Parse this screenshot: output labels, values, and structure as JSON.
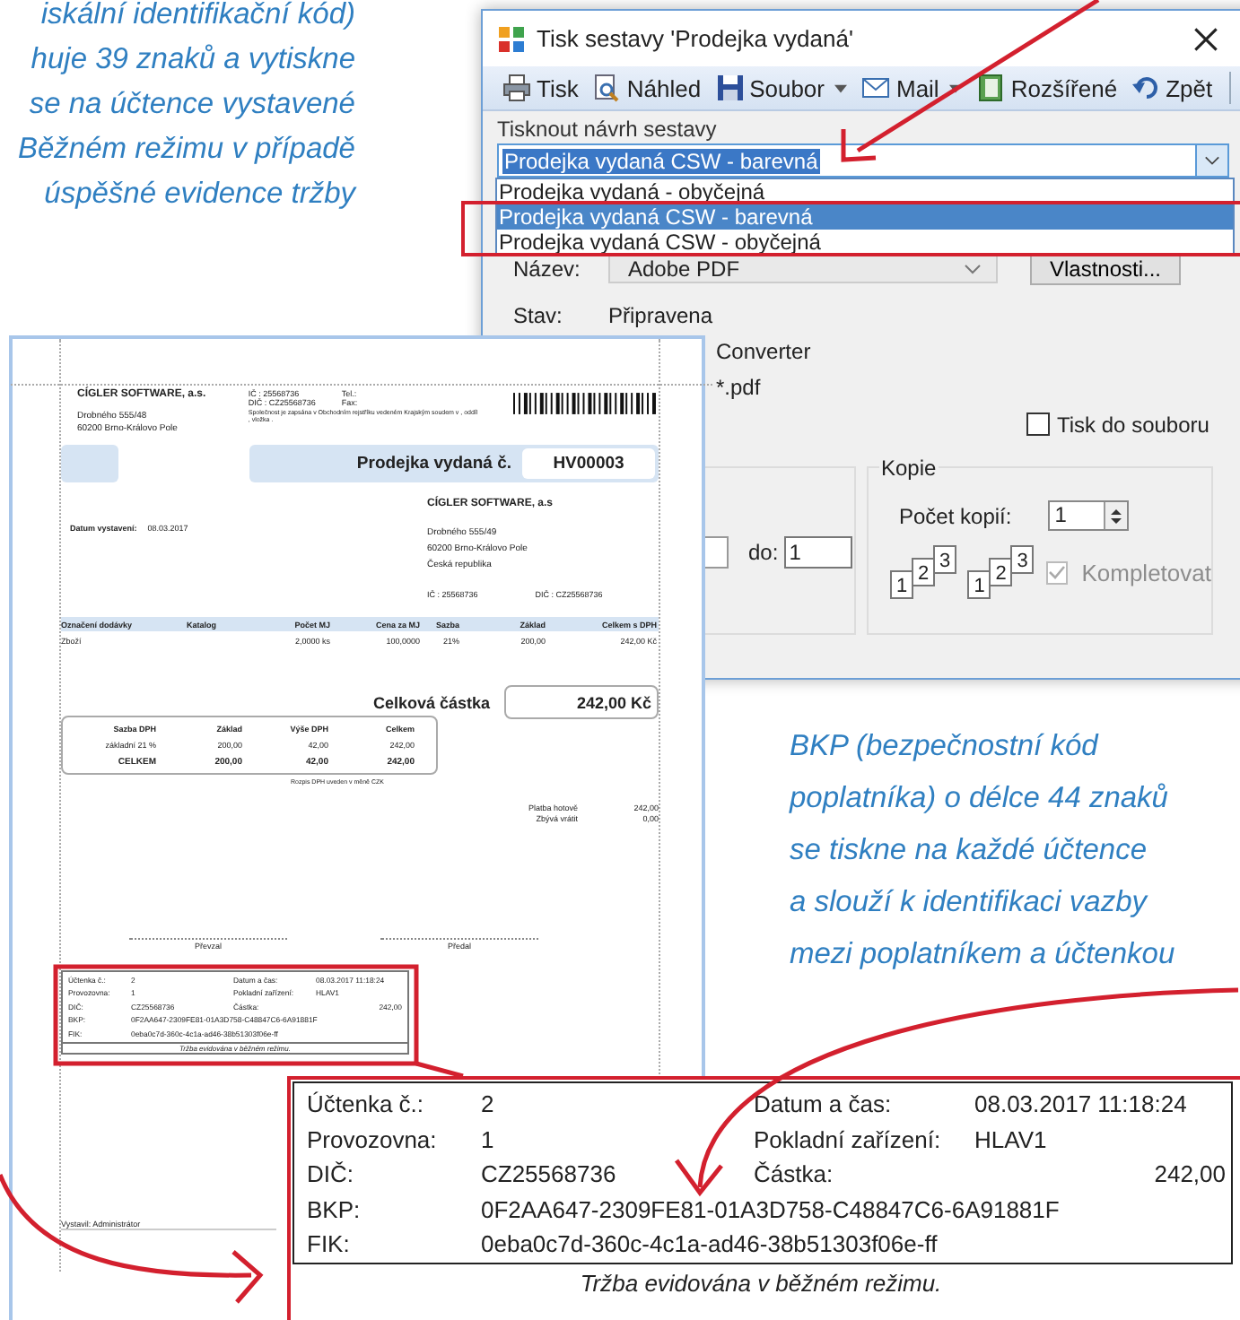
{
  "annotations": {
    "top_left": [
      "iskální identifikační kód)",
      "huje 39 znaků a vytiskne",
      "se na účtence vystavené",
      "Běžném režimu v případě",
      "úspěšné evidence tržby"
    ],
    "bottom_right": [
      "BKP (bezpečnostní kód",
      "poplatníka) o délce 44 znaků",
      "se tiskne na každé účtence",
      "a slouží k identifikaci vazby",
      "mezi poplatníkem a účtenkou"
    ]
  },
  "print_dialog": {
    "title": "Tisk sestavy 'Prodejka vydaná'",
    "toolbar": [
      {
        "label": "Tisk",
        "dropdown": false
      },
      {
        "label": "Náhled",
        "dropdown": false
      },
      {
        "label": "Soubor",
        "dropdown": true
      },
      {
        "label": "Mail",
        "dropdown": true
      },
      {
        "label": "Rozšířené",
        "dropdown": false
      },
      {
        "label": "Zpět",
        "dropdown": false
      }
    ],
    "template_label": "Tisknout návrh sestavy",
    "template_value": "Prodejka vydaná CSW - barevná",
    "template_options": [
      {
        "label": "Prodejka vydaná - obyčejná",
        "selected": false
      },
      {
        "label": "Prodejka vydaná CSW - barevná",
        "selected": true
      },
      {
        "label": "Prodejka vydaná CSW - obyčejná",
        "selected": false
      }
    ],
    "printer": {
      "name_label": "Název:",
      "name_value": "Adobe PDF",
      "properties_button": "Vlastnosti...",
      "status_label": "Stav:",
      "status_value": "Připravena",
      "type_value": "Converter",
      "port_value": "*.pdf"
    },
    "print_to_file": {
      "label": "Tisk do souboru",
      "checked": false
    },
    "range": {
      "to_label": "do:",
      "to_value": "1"
    },
    "copies": {
      "title": "Kopie",
      "count_label": "Počet kopií:",
      "count_value": "1",
      "collate_stacks": [
        [
          "1",
          "2",
          "3"
        ],
        [
          "1",
          "2",
          "3"
        ]
      ],
      "collate_label": "Kompletovat",
      "collate_checked": true,
      "collate_disabled": true
    }
  },
  "preview": {
    "company": {
      "name": "CÍGLER SOFTWARE, a.s.",
      "address": [
        "Drobného 555/48",
        "60200  Brno-Královo Pole"
      ]
    },
    "ids": [
      "IČ : 25568736",
      "DIČ : CZ25568736"
    ],
    "contacts": [
      "Tel.:",
      "Fax:"
    ],
    "registry": "Společnost je zapsána v Obchodním rejstříku vedeném Krajským soudem v   , oddíl , vložka .",
    "title": "Prodejka vydaná č.",
    "number": "HV00003",
    "date_label": "Datum vystavení:",
    "date_value": "08.03.2017",
    "recipient": {
      "name": "CÍGLER SOFTWARE, a.s",
      "lines": [
        "Drobného 555/49",
        "60200  Brno-Královo Pole",
        "Česká republika"
      ],
      "ic": "IČ : 25568736",
      "dic": "DIČ : CZ25568736"
    },
    "items": {
      "columns": [
        "Označení dodávky",
        "Katalog",
        "Počet MJ",
        "Cena za MJ",
        "Sazba",
        "Základ",
        "Celkem s DPH"
      ],
      "rows": [
        {
          "name": "Zboží",
          "qty": "2,0000 ks",
          "price": "100,0000",
          "rate": "21%",
          "base": "200,00",
          "total": "242,00 Kč"
        }
      ]
    },
    "total_label": "Celková částka",
    "total_value": "242,00 Kč",
    "vat": {
      "columns": [
        "Sazba DPH",
        "Základ",
        "Výše DPH",
        "Celkem"
      ],
      "rows": [
        [
          "základní 21 %",
          "200,00",
          "42,00",
          "242,00"
        ]
      ],
      "total": [
        "CELKEM",
        "200,00",
        "42,00",
        "242,00"
      ]
    },
    "vat_note": "Rozpis DPH uveden v měně CZK",
    "payment": [
      {
        "label": "Platba hotově",
        "value": "242,00"
      },
      {
        "label": "Zbývá vrátit",
        "value": "0,00"
      }
    ],
    "signatures": [
      "Převzal",
      "Předal"
    ],
    "receipt": {
      "rows": [
        {
          "label": "Účtenka č.:",
          "value": "2",
          "label2": "Datum a čas:",
          "value2": "08.03.2017 11:18:24"
        },
        {
          "label": "Provozovna:",
          "value": "1",
          "label2": "Pokladní zařízení:",
          "value2": "HLAV1"
        },
        {
          "label": "DIČ:",
          "value": "CZ25568736",
          "label2": "Částka:",
          "value2": "242,00"
        },
        {
          "label": "BKP:",
          "value": "0F2AA647-2309FE81-01A3D758-C48847C6-6A91881F"
        },
        {
          "label": "FIK:",
          "value": "0eba0c7d-360c-4c1a-ad46-38b51303f06e-ff"
        }
      ],
      "footer": "Tržba evidována v běžném režimu."
    },
    "issued_by": "Vystavil: Administrátor"
  },
  "receipt_zoom": {
    "rows": [
      {
        "label": "Účtenka č.:",
        "value": "2",
        "label2": "Datum a čas:",
        "value2": "08.03.2017 11:18:24"
      },
      {
        "label": "Provozovna:",
        "value": "1",
        "label2": "Pokladní zařízení:",
        "value2": "HLAV1"
      },
      {
        "label": "DIČ:",
        "value": "CZ25568736",
        "label2": "Částka:",
        "value2": "242,00"
      },
      {
        "label": "BKP:",
        "value": "0F2AA647-2309FE81-01A3D758-C48847C6-6A91881F"
      },
      {
        "label": "FIK:",
        "value": "0eba0c7d-360c-4c1a-ad46-38b51303f06e-ff"
      }
    ],
    "footer": "Tržba evidována v běžném režimu."
  }
}
